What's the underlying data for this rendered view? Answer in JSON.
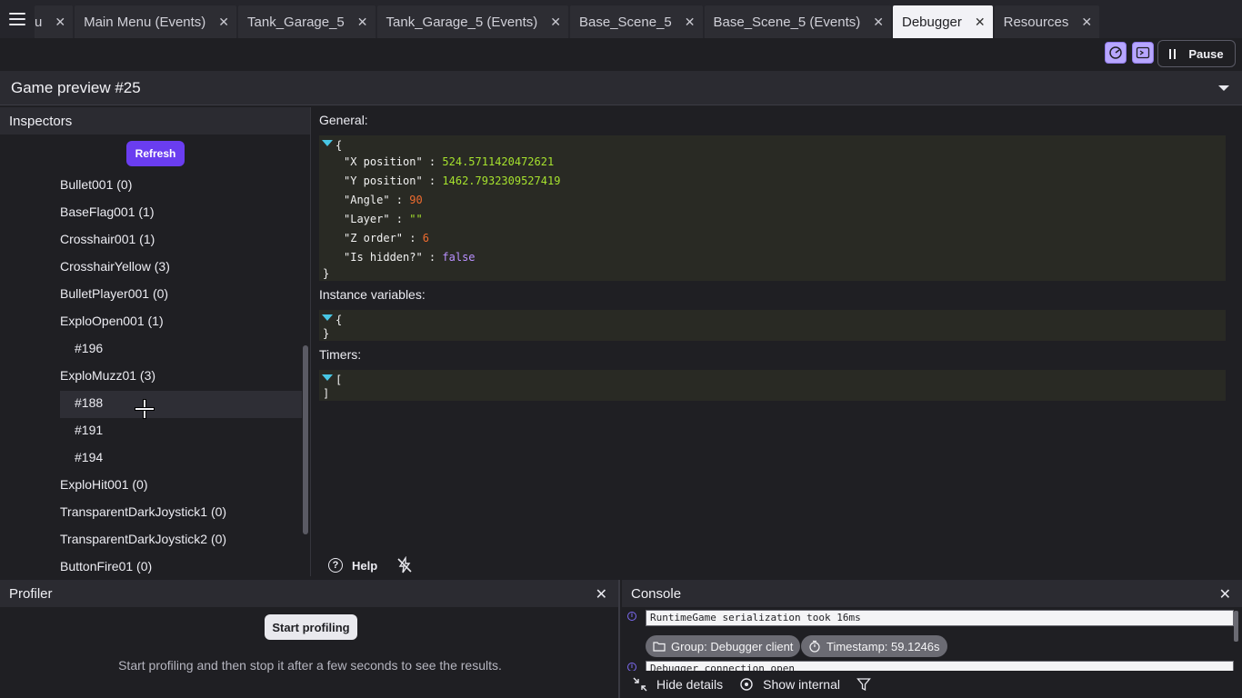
{
  "tabs": [
    {
      "label": "u",
      "active": false
    },
    {
      "label": "Main Menu (Events)",
      "active": false
    },
    {
      "label": "Tank_Garage_5",
      "active": false
    },
    {
      "label": "Tank_Garage_5 (Events)",
      "active": false
    },
    {
      "label": "Base_Scene_5",
      "active": false
    },
    {
      "label": "Base_Scene_5 (Events)",
      "active": false
    },
    {
      "label": "Debugger",
      "active": true
    },
    {
      "label": "Resources",
      "active": false
    }
  ],
  "toolbar": {
    "pause_label": "Pause"
  },
  "preview": {
    "title": "Game preview #25"
  },
  "inspectors": {
    "title": "Inspectors",
    "refresh_label": "Refresh",
    "items": [
      {
        "label": "Bullet001 (0)"
      },
      {
        "label": "BaseFlag001 (1)"
      },
      {
        "label": "Crosshair001 (1)"
      },
      {
        "label": "CrosshairYellow (3)"
      },
      {
        "label": "BulletPlayer001 (0)"
      },
      {
        "label": "ExploOpen001 (1)"
      },
      {
        "label": "#196"
      },
      {
        "label": "ExploMuzz01 (3)"
      },
      {
        "label": "#188",
        "selected": true
      },
      {
        "label": "#191"
      },
      {
        "label": "#194"
      },
      {
        "label": "ExploHit001 (0)"
      },
      {
        "label": "TransparentDarkJoystick1 (0)"
      },
      {
        "label": "TransparentDarkJoystick2 (0)"
      },
      {
        "label": "ButtonFire01 (0)"
      }
    ]
  },
  "details": {
    "general_label": "General:",
    "general_open": "{",
    "general_close": "}",
    "fields": [
      {
        "key": "\"X position\"",
        "value": "524.5711420472621",
        "kind": "str"
      },
      {
        "key": "\"Y position\"",
        "value": "1462.7932309527419",
        "kind": "str"
      },
      {
        "key": "\"Angle\"",
        "value": "90",
        "kind": "num"
      },
      {
        "key": "\"Layer\"",
        "value": "\"\"",
        "kind": "str"
      },
      {
        "key": "\"Z order\"",
        "value": "6",
        "kind": "num"
      },
      {
        "key": "\"Is hidden?\"",
        "value": "false",
        "kind": "bool"
      }
    ],
    "instance_label": "Instance variables:",
    "instance_open": "{",
    "instance_close": "}",
    "timers_label": "Timers:",
    "timers_open": "[",
    "timers_close": "]",
    "help_label": "Help"
  },
  "profiler": {
    "title": "Profiler",
    "start_label": "Start profiling",
    "hint": "Start profiling and then stop it after a few seconds to see the results."
  },
  "console": {
    "title": "Console",
    "lines": [
      "RuntimeGame serialization took 16ms",
      "Debugger connection open"
    ],
    "group_chip": "Group: Debugger client",
    "timestamp_chip": "Timestamp: 59.1246s",
    "hide_details": "Hide details",
    "show_internal": "Show internal"
  },
  "colors": {
    "accent": "#6a3df0",
    "json_bg": "#292a24",
    "number": "#ee6b2f",
    "string": "#a6e22e",
    "boolean": "#b990ff"
  }
}
